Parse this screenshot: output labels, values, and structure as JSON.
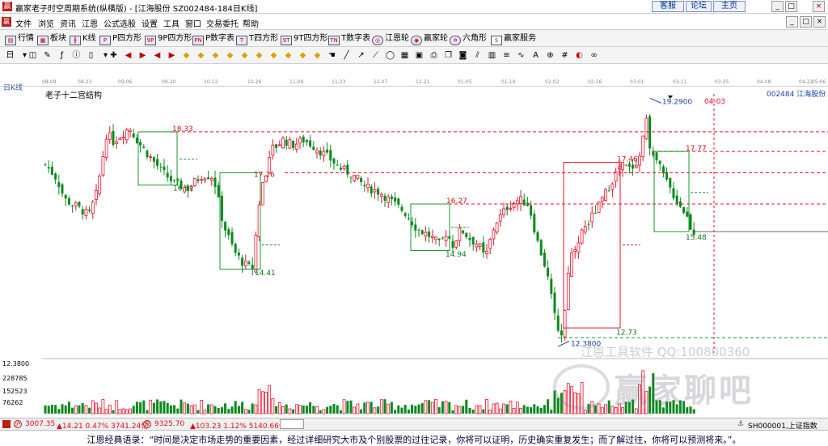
{
  "window": {
    "title": "赢家老子时空周期系统(纵横版) - [江海股份  SZ002484-184日K线]",
    "header_links": [
      "客服",
      "论坛",
      "主页"
    ],
    "controls": [
      "_",
      "□",
      "×"
    ],
    "sub_controls": [
      "_",
      "□",
      "×"
    ]
  },
  "menu": [
    "文件",
    "浏览",
    "资讯",
    "江恩",
    "公式选股",
    "设置",
    "工具",
    "窗口",
    "交易委托",
    "帮助"
  ],
  "toolbar1": [
    {
      "label": "行情",
      "icon": "quote-icon"
    },
    {
      "label": "板块",
      "icon": "sector-icon"
    },
    {
      "label": "K线",
      "icon": "kline-icon"
    },
    {
      "label": "P四方形",
      "icon": "p-square-icon"
    },
    {
      "label": "9P四方形",
      "icon": "9p-square-icon"
    },
    {
      "label": "P数字表",
      "icon": "p-number-table-icon"
    },
    {
      "label": "T四方形",
      "icon": "t-square-icon"
    },
    {
      "label": "9T四方形",
      "icon": "9t-square-icon"
    },
    {
      "label": "T数字表",
      "icon": "t-number-table-icon"
    },
    {
      "label": "江恩轮",
      "icon": "gann-wheel-icon"
    },
    {
      "label": "赢家轮",
      "icon": "winner-wheel-icon"
    },
    {
      "label": "六角形",
      "icon": "hexagon-icon"
    },
    {
      "label": "赢家服务",
      "icon": "service-icon"
    }
  ],
  "toolbar2_icons": [
    "period-icon",
    "dropdown-icon",
    "chart-style-icon",
    "draw-icon",
    "formula-icon",
    "info-icon",
    "indicator-icon",
    "dropdown-icon",
    "cross-cursor-icon",
    "arrow-left-icon",
    "arrow-right-icon",
    "arrow-left-icon",
    "arrow-right-icon",
    "diamond-icon",
    "diamond-icon",
    "diamond-icon",
    "diamond-icon",
    "diamond-icon",
    "diamond-icon",
    "diamond-icon",
    "diamond-icon",
    "diamond-icon",
    "diamond-icon",
    "hand-icon",
    "line-icon",
    "arrow-icon",
    "ray-icon",
    "ellipse-icon",
    "table-icon",
    "save-icon",
    "print-icon",
    "copy-icon",
    "camera-icon",
    "line-stat-icon",
    "chart-icon",
    "fib-icon",
    "cycle-icon",
    "text-icon",
    "zoom-icon",
    "grid-icon",
    "color-icon",
    "loop-icon"
  ],
  "period_label": "日K线",
  "chart_title": "老子十二宫结构",
  "stock_label": "002484  江海股份",
  "date_ticks": [
    "08-09",
    "08-23",
    "09-06",
    "09-20",
    "10-12",
    "10-26",
    "11-09",
    "11-23",
    "12-07",
    "12-21",
    "01-05",
    "01-19",
    "02-02",
    "02-16",
    "03-01",
    "03-11",
    "03-25",
    "04-08",
    "04-22",
    "05-06"
  ],
  "vline_label": "04-03",
  "volume_axis": [
    "12.3800",
    "228785",
    "152523",
    "76262"
  ],
  "watermarks": [
    "江恩工具软件  QQ:100800360",
    "赢家聊吧"
  ],
  "status": {
    "sh": "3007.35",
    "sh_change": "▲14.21 0.47% 3741.24亿",
    "sz": "9325.70",
    "sz_change": "▲103.23 1.12% 5140.66亿",
    "index_code": "SH000001,上证指数"
  },
  "footer_quote": "江恩经典语录：“时间是决定市场走势的重要因素，经过详细研究大市及个别股票的过往记录，你将可以证明，历史确实重复发生；而了解过往，你将可以预测将来。”。",
  "chart_data": {
    "type": "candlestick",
    "price_range": [
      11.9,
      19.6
    ],
    "annotations": [
      {
        "label": "19.2900",
        "price": 19.29,
        "kind": "high"
      },
      {
        "label": "18.33",
        "price": 18.33,
        "kind": "level"
      },
      {
        "label": "17.77",
        "price": 17.77,
        "kind": "level"
      },
      {
        "label": "17.46",
        "price": 17.46,
        "kind": "level"
      },
      {
        "label": "17.16",
        "price": 17.16,
        "kind": "level"
      },
      {
        "label": "16.81",
        "price": 16.81,
        "kind": "level"
      },
      {
        "label": "16.27",
        "price": 16.27,
        "kind": "level"
      },
      {
        "label": "15.48",
        "price": 15.48,
        "kind": "level"
      },
      {
        "label": "14.94",
        "price": 14.94,
        "kind": "level"
      },
      {
        "label": "14.41",
        "price": 14.41,
        "kind": "level"
      },
      {
        "label": "12.73",
        "price": 12.73,
        "kind": "level"
      },
      {
        "label": "12.3800",
        "price": 12.38,
        "kind": "low"
      }
    ],
    "volume_ticks": [
      228785,
      152523,
      76262
    ],
    "colors": {
      "up": "#e8102b",
      "down": "#0b8a1e",
      "level": "#e8102b",
      "box_green": "#1a9a2e",
      "box_red": "#e8102b",
      "label_green": "#0b7a1e",
      "label_red": "#d4101b",
      "label_blue": "#1a3fa8",
      "status_up": "#d4101b"
    }
  }
}
